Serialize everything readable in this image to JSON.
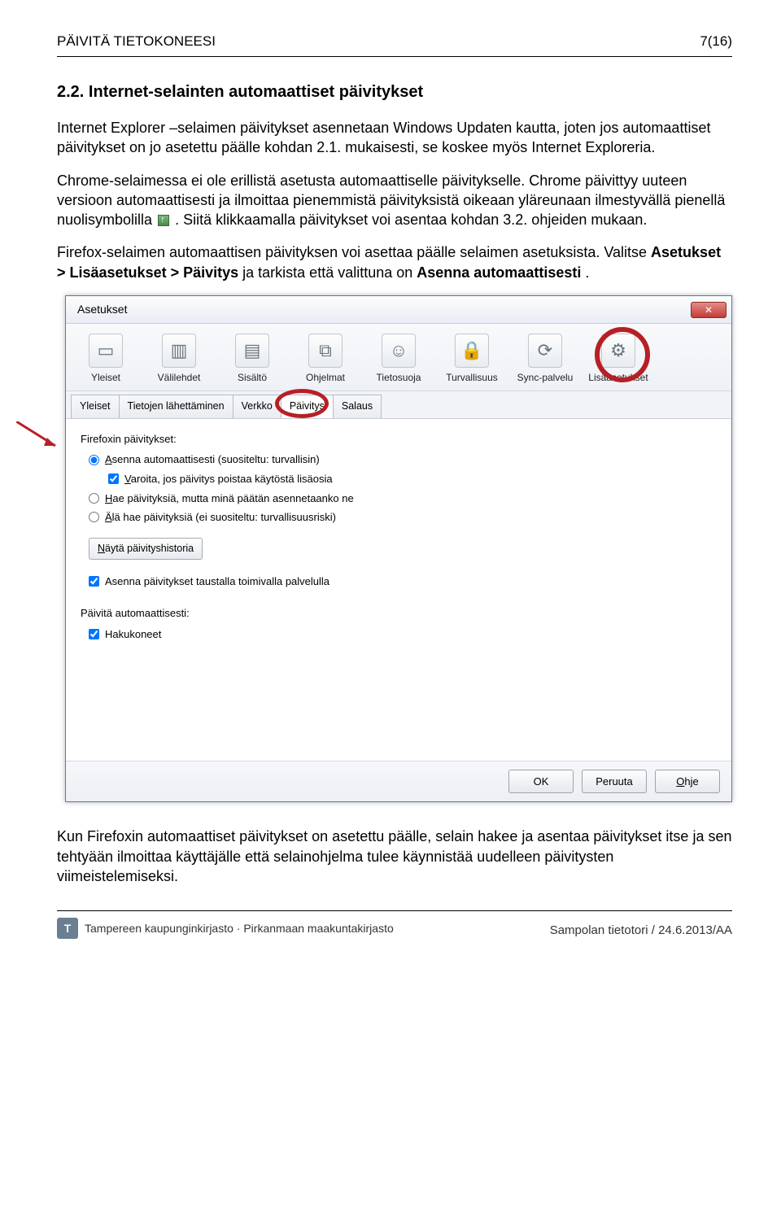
{
  "header": {
    "left": "PÄIVITÄ TIETOKONEESI",
    "right": "7(16)"
  },
  "section_title": "2.2. Internet-selainten automaattiset päivitykset",
  "para1": "Internet Explorer –selaimen päivitykset asennetaan Windows Updaten kautta, joten jos automaattiset päivitykset on jo asetettu päälle kohdan 2.1. mukaisesti, se koskee myös Internet Exploreria.",
  "para2a": "Chrome-selaimessa ei ole erillistä asetusta automaattiselle päivitykselle. Chrome päivittyy uuteen versioon automaattisesti ja ilmoittaa pienemmistä päivityksistä oikeaan yläreunaan ilmestyvällä pienellä nuolisymbolilla ",
  "para2b": ". Siitä klikkaamalla päivitykset voi asentaa kohdan 3.2. ohjeiden mukaan.",
  "para3a": "Firefox-selaimen automaattisen päivityksen voi asettaa päälle selaimen asetuksista. Valitse ",
  "para3b": "Asetukset > Lisäasetukset > Päivitys",
  "para3c": " ja tarkista että valittuna on ",
  "para3d": "Asenna automaattisesti",
  "para3e": ".",
  "dialog": {
    "title": "Asetukset",
    "toolbar": [
      {
        "label": "Yleiset",
        "glyph": "▭"
      },
      {
        "label": "Välilehdet",
        "glyph": "▥"
      },
      {
        "label": "Sisältö",
        "glyph": "▤"
      },
      {
        "label": "Ohjelmat",
        "glyph": "⧉"
      },
      {
        "label": "Tietosuoja",
        "glyph": "☺"
      },
      {
        "label": "Turvallisuus",
        "glyph": "🔒"
      },
      {
        "label": "Sync-palvelu",
        "glyph": "⟳"
      },
      {
        "label": "Lisäasetukset",
        "glyph": "⚙",
        "highlight": true
      }
    ],
    "subtabs": [
      {
        "label": "Yleiset"
      },
      {
        "label": "Tietojen lähettäminen"
      },
      {
        "label": "Verkko"
      },
      {
        "label": "Päivitys",
        "active": true,
        "highlight": true
      },
      {
        "label": "Salaus"
      }
    ],
    "group1_label": "Firefoxin päivitykset:",
    "opts": {
      "r1": "Asenna automaattisesti (suositeltu: turvallisin)",
      "c1": "Varoita, jos päivitys poistaa käytöstä lisäosia",
      "r2": "Hae päivityksiä, mutta minä päätän asennetaanko ne",
      "r3": "Älä hae päivityksiä (ei suositeltu: turvallisuusriski)",
      "btn_hist": "Näytä päivityshistoria",
      "c2": "Asenna päivitykset taustalla toimivalla palvelulla",
      "group2_label": "Päivitä automaattisesti:",
      "c3": "Hakukoneet"
    },
    "buttons": {
      "ok": "OK",
      "cancel": "Peruuta",
      "help": "Ohje"
    }
  },
  "para4": "Kun Firefoxin automaattiset päivitykset on asetettu päälle, selain hakee ja asentaa päivitykset itse ja sen tehtyään ilmoittaa käyttäjälle että selainohjelma tulee käynnistää uudelleen päivitysten viimeistelemiseksi.",
  "footer": {
    "logo_text": "Tampereen kaupunginkirjasto · Pirkanmaan maakuntakirjasto",
    "right": "Sampolan tietotori / 24.6.2013/AA"
  }
}
